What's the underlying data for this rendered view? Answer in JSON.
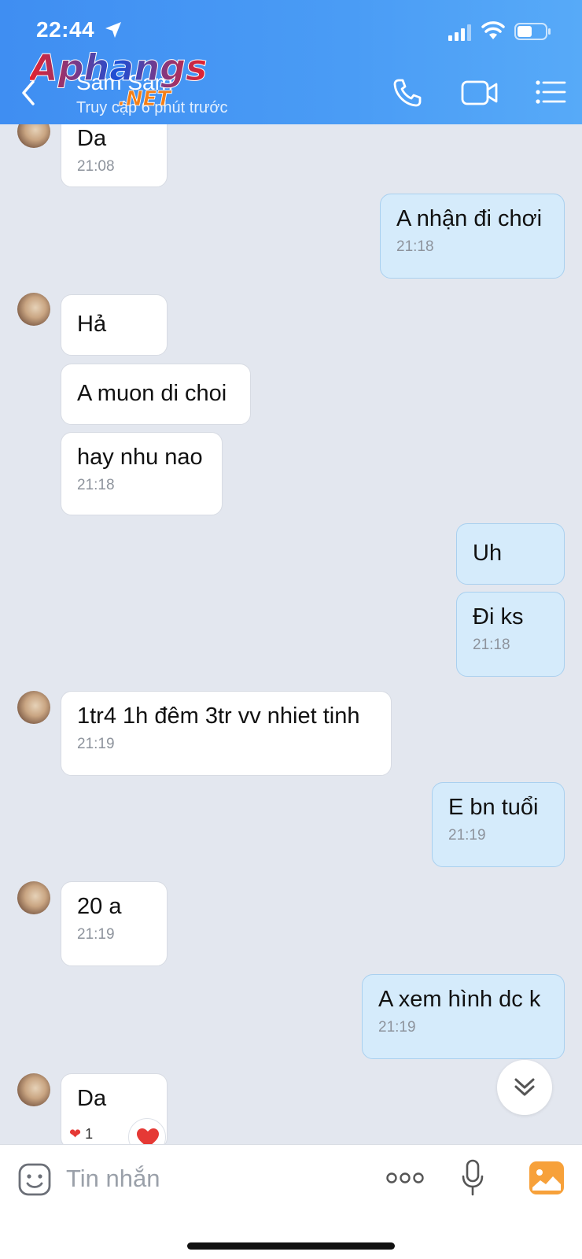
{
  "status_bar": {
    "time": "22:44"
  },
  "header": {
    "contact_name": "Sam Sam",
    "contact_status": "Truy cập 6 phút trước",
    "watermark": "Aphangs .NET"
  },
  "messages": [
    {
      "dir": "in",
      "text": "Da",
      "time": "21:08"
    },
    {
      "dir": "out",
      "text": "A nhận đi chơi",
      "time": "21:18"
    },
    {
      "dir": "in",
      "text": "Hả",
      "time": ""
    },
    {
      "dir": "in",
      "text": "A muon di choi",
      "time": ""
    },
    {
      "dir": "in",
      "text": "hay nhu nao",
      "time": "21:18"
    },
    {
      "dir": "out",
      "text": "Uh",
      "time": ""
    },
    {
      "dir": "out",
      "text": "Đi ks",
      "time": "21:18"
    },
    {
      "dir": "in",
      "text": "1tr4 1h đêm 3tr vv nhiet tinh",
      "time": "21:19"
    },
    {
      "dir": "out",
      "text": "E bn tuổi",
      "time": "21:19"
    },
    {
      "dir": "in",
      "text": "20 a",
      "time": "21:19"
    },
    {
      "dir": "out",
      "text": "A xem hình dc k",
      "time": "21:19"
    },
    {
      "dir": "in",
      "text": "Da",
      "time": ""
    }
  ],
  "reaction": {
    "emoji": "❤",
    "count": "1"
  },
  "input": {
    "placeholder": "Tin nhắn"
  },
  "colors": {
    "header": "#4a9cf5",
    "incoming": "#ffffff",
    "outgoing": "#d5ebfb",
    "background": "#e3e7ef"
  }
}
